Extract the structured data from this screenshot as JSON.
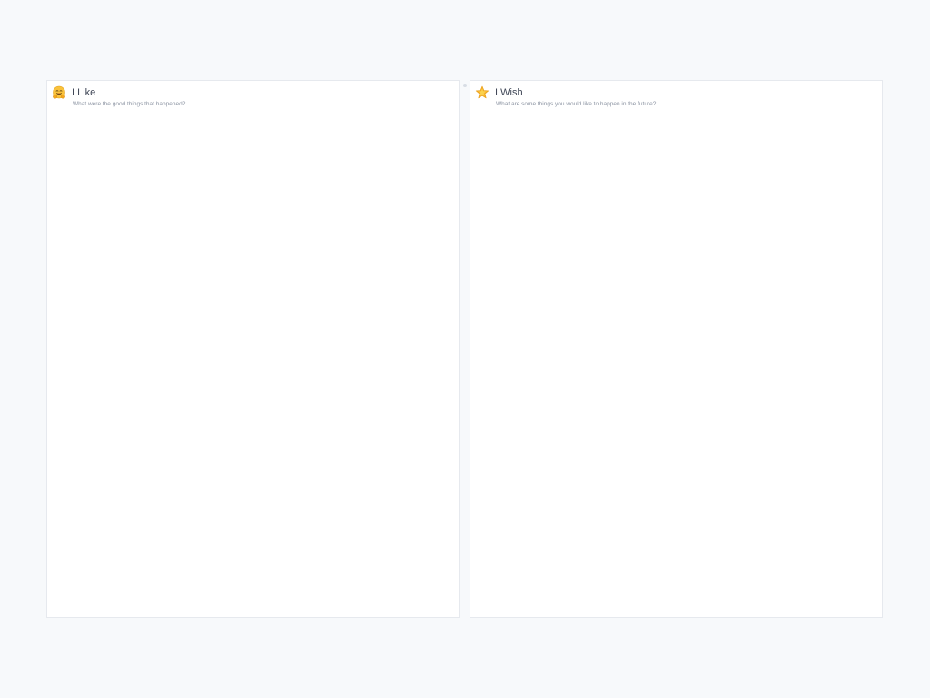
{
  "columns": [
    {
      "title": "I Like",
      "subtitle": "What were the good things that happened?",
      "icon": "hugging-face-icon"
    },
    {
      "title": "I Wish",
      "subtitle": "What are some things you would like to happen in the future?",
      "icon": "glowing-star-icon"
    }
  ],
  "colors": {
    "background": "#f7f9fb",
    "card": "#ffffff",
    "title": "#3f4656",
    "subtitle": "#8d95a3",
    "emoji_yellow": "#f7b731"
  }
}
